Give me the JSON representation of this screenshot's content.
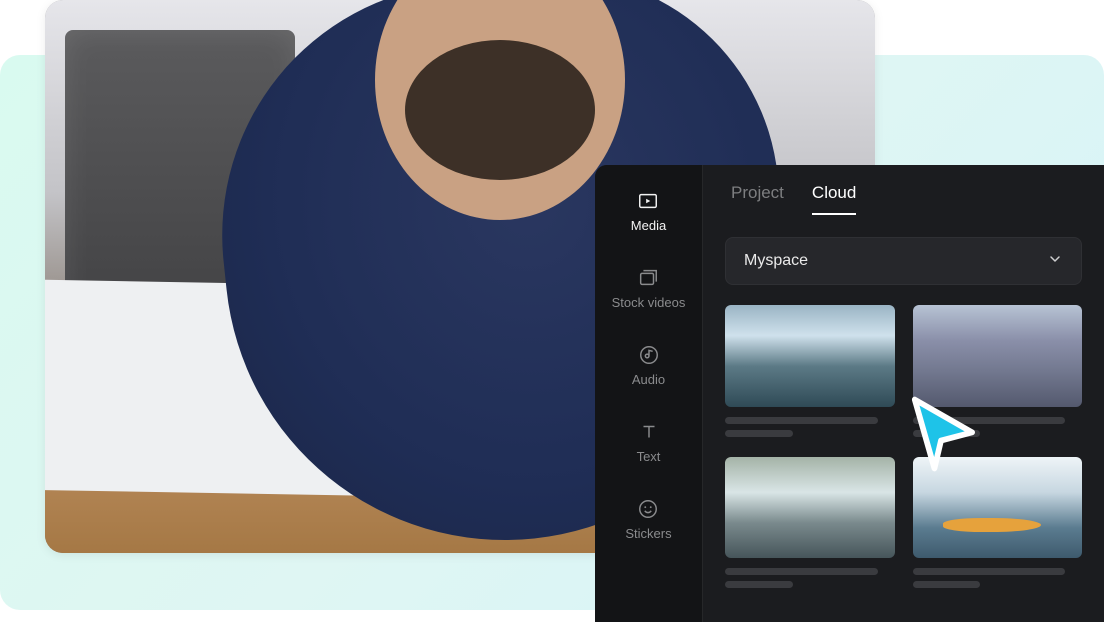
{
  "sidebar": {
    "items": [
      {
        "id": "media",
        "label": "Media",
        "active": true
      },
      {
        "id": "stock-videos",
        "label": "Stock videos",
        "active": false
      },
      {
        "id": "audio",
        "label": "Audio",
        "active": false
      },
      {
        "id": "text",
        "label": "Text",
        "active": false
      },
      {
        "id": "stickers",
        "label": "Stickers",
        "active": false
      }
    ]
  },
  "tabs": [
    {
      "id": "project",
      "label": "Project",
      "active": false
    },
    {
      "id": "cloud",
      "label": "Cloud",
      "active": true
    }
  ],
  "dropdown": {
    "selected": "Myspace"
  },
  "cards": [
    {
      "id": "winter-lake"
    },
    {
      "id": "beach-sunset"
    },
    {
      "id": "river-aerial"
    },
    {
      "id": "kayak"
    }
  ],
  "colors": {
    "panel_bg": "#1b1c1f",
    "accent_cursor": "#1ec3e8"
  }
}
